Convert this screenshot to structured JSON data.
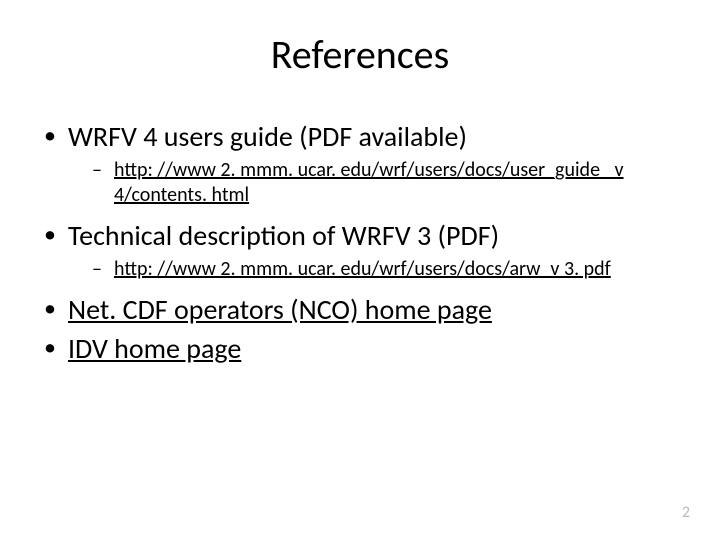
{
  "title": "References",
  "items": [
    {
      "text": "WRFV 4 users guide (PDF available)",
      "isLink": false,
      "sub": [
        {
          "text": "http: //www 2. mmm. ucar. edu/wrf/users/docs/user_guide_ v 4/contents. html",
          "isLink": true
        }
      ]
    },
    {
      "text": "Technical description of WRFV 3 (PDF)",
      "isLink": false,
      "sub": [
        {
          "text": "http: //www 2. mmm. ucar. edu/wrf/users/docs/arw_v 3. pdf",
          "isLink": true
        }
      ]
    },
    {
      "text": "Net. CDF operators (NCO) home page",
      "isLink": true,
      "sub": []
    },
    {
      "text": "IDV home page",
      "isLink": true,
      "sub": []
    }
  ],
  "pageNumber": "2"
}
